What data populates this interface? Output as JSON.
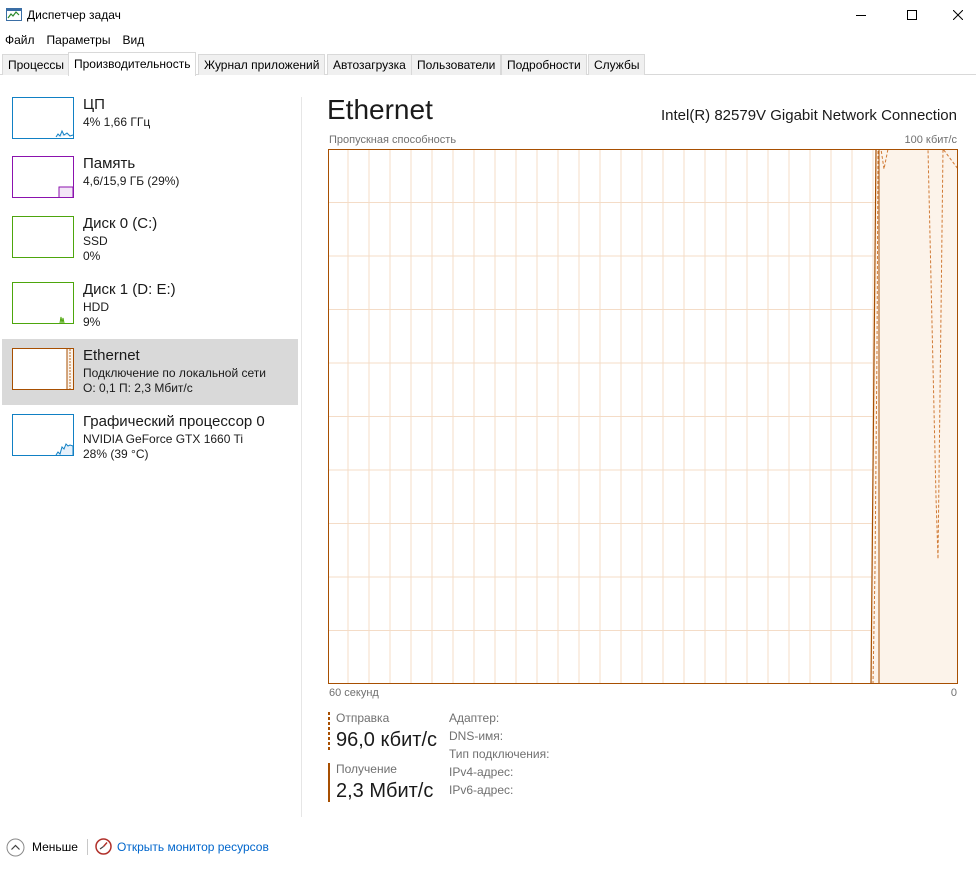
{
  "window": {
    "title": "Диспетчер задач"
  },
  "menu": [
    "Файл",
    "Параметры",
    "Вид"
  ],
  "tabs": [
    {
      "label": "Процессы",
      "active": false
    },
    {
      "label": "Производительность",
      "active": true
    },
    {
      "label": "Журнал приложений",
      "active": false
    },
    {
      "label": "Автозагрузка",
      "active": false
    },
    {
      "label": "Пользователи",
      "active": false
    },
    {
      "label": "Подробности",
      "active": false
    },
    {
      "label": "Службы",
      "active": false
    }
  ],
  "sidebar": {
    "items": [
      {
        "title": "ЦП",
        "line1": "4%  1,66 ГГц",
        "line2": "",
        "color": "#1180c4"
      },
      {
        "title": "Память",
        "line1": "4,6/15,9 ГБ (29%)",
        "line2": "",
        "color": "#8b12ae"
      },
      {
        "title": "Диск 0 (C:)",
        "line1": "SSD",
        "line2": "0%",
        "color": "#4da60c"
      },
      {
        "title": "Диск 1 (D: E:)",
        "line1": "HDD",
        "line2": "9%",
        "color": "#4da60c"
      },
      {
        "title": "Ethernet",
        "line1": "Подключение по локальной сети",
        "line2": "О: 0,1  П: 2,3 Мбит/с",
        "color": "#a74f01",
        "selected": true
      },
      {
        "title": "Графический процессор 0",
        "line1": "NVIDIA GeForce GTX 1660 Ti",
        "line2": "28% (39 °C)",
        "color": "#1180c4"
      }
    ]
  },
  "main": {
    "title": "Ethernet",
    "adapter": "Intel(R) 82579V Gigabit Network Connection",
    "graph_label": "Пропускная способность",
    "graph_max": "100 кбит/с",
    "axis_left": "60 секунд",
    "axis_right": "0",
    "send": {
      "label": "Отправка",
      "value": "96,0 кбит/с"
    },
    "receive": {
      "label": "Получение",
      "value": "2,3 Мбит/с"
    },
    "info_labels": [
      "Адаптер:",
      "DNS-имя:",
      "Тип подключения:",
      "IPv4-адрес:",
      "IPv6-адрес:"
    ]
  },
  "footer": {
    "less_label": "Меньше",
    "resmon_link": "Открыть монитор ресурсов"
  },
  "colors": {
    "ethernet": "#a74f01",
    "graph_grid": "#f4dcc7",
    "graph_fill": "#fcf3ea",
    "link": "#0066cc"
  },
  "icons": {
    "app": "task-manager-icon",
    "less": "chevron-up-icon",
    "resmon": "resource-monitor-icon"
  }
}
